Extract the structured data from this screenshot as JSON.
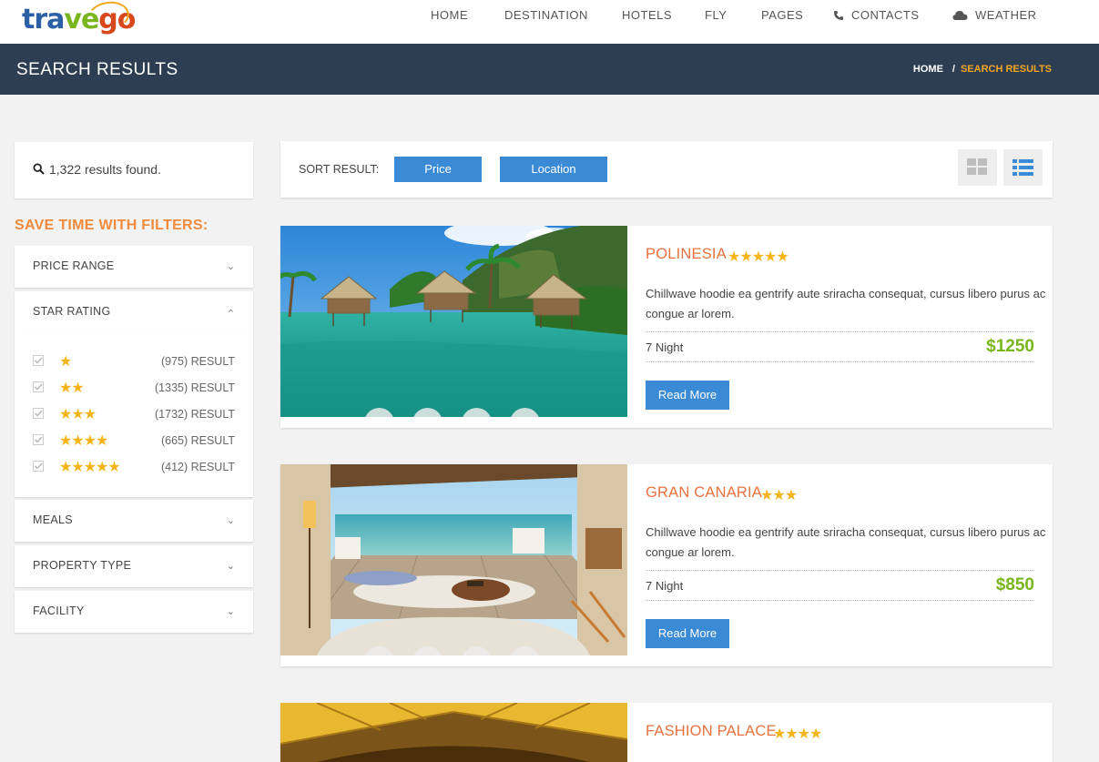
{
  "brand": {
    "logo_a": "tra",
    "logo_b": "ve",
    "logo_c": "go"
  },
  "nav": {
    "items": [
      {
        "label": "HOME"
      },
      {
        "label": "DESTINATION"
      },
      {
        "label": "HOTELS"
      },
      {
        "label": "FLY"
      },
      {
        "label": "PAGES"
      },
      {
        "label": "CONTACTS",
        "icon": "phone-icon"
      },
      {
        "label": "WEATHER",
        "icon": "cloud-icon"
      }
    ]
  },
  "header": {
    "title": "SEARCH RESULTS",
    "breadcrumb": {
      "home": "HOME",
      "separator": "/",
      "current": "SEARCH RESULTS"
    }
  },
  "sidebar": {
    "results_count": "1,322",
    "results_suffix": "results found.",
    "filters_heading": "SAVE TIME WITH FILTERS:",
    "filters": {
      "price_range": "PRICE RANGE",
      "star_rating": "STAR RATING",
      "meals": "MEALS",
      "property_type": "PROPERTY TYPE",
      "facility": "FACILITY"
    },
    "star_options": [
      {
        "stars": "★",
        "count": "(975) RESULT"
      },
      {
        "stars": "★★",
        "count": "(1335) RESULT"
      },
      {
        "stars": "★★★",
        "count": "(1732) RESULT"
      },
      {
        "stars": "★★★★",
        "count": "(665) RESULT"
      },
      {
        "stars": "★★★★★",
        "count": "(412) RESULT"
      }
    ]
  },
  "sort": {
    "label": "SORT RESULT:",
    "price_label": "Price",
    "location_label": "Location"
  },
  "results": [
    {
      "title": "POLINESIA",
      "stars": "★★★★★",
      "description": "Chillwave hoodie ea gentrify aute sriracha consequat, cursus libero purus ac congue ar lorem.",
      "nights": "7 Night",
      "price": "$1250",
      "button": "Read More"
    },
    {
      "title": "GRAN CANARIA",
      "stars": "★★★",
      "description": "Chillwave hoodie ea gentrify aute sriracha consequat, cursus libero purus ac congue ar lorem.",
      "nights": "7 Night",
      "price": "$850",
      "button": "Read More"
    },
    {
      "title": "FASHION PALACE",
      "stars": "★★★★"
    }
  ],
  "colors": {
    "accent": "#3a8ad6",
    "title": "#e8723f",
    "price": "#79b51c",
    "stars": "#f4b51b",
    "band": "#2d3e52"
  }
}
